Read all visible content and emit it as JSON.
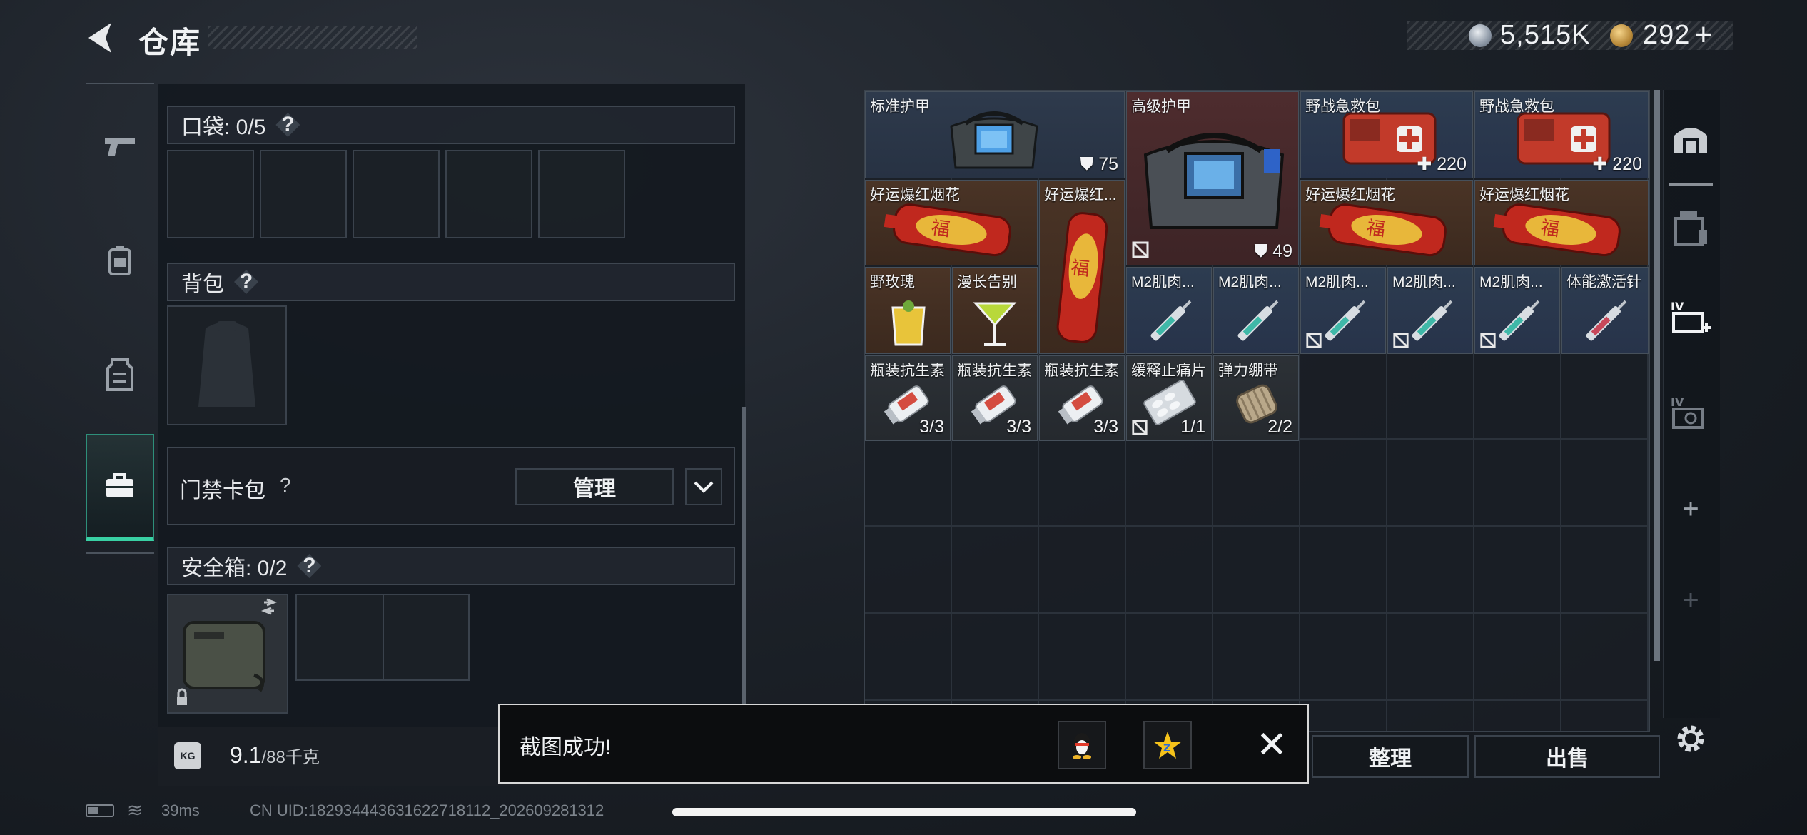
{
  "header": {
    "title": "仓库",
    "currency_silver": "5,515K",
    "currency_gold": "292",
    "plus": "+"
  },
  "nav": [
    "pistol-icon",
    "backpack-gear-icon",
    "vest-icon",
    "briefcase-icon"
  ],
  "pocket": {
    "label": "口袋: 0/5",
    "help": "?"
  },
  "backpack": {
    "label": "背包",
    "help": "?"
  },
  "keycard": {
    "label": "门禁卡包",
    "help": "?",
    "manage": "管理"
  },
  "safe_box": {
    "label": "安全箱: 0/2",
    "help": "?"
  },
  "weight": {
    "current": "9.1",
    "max": "/88千克",
    "icon": "KG"
  },
  "stash_items": [
    {
      "name": "标准护甲",
      "count": "75",
      "badge": "shield"
    },
    {
      "name": "高级护甲",
      "count": "49",
      "badge": "shield"
    },
    {
      "name": "野战急救包",
      "count": "220",
      "badge": "plus"
    },
    {
      "name": "野战急救包",
      "count": "220",
      "badge": "plus"
    },
    {
      "name": "好运爆红烟花",
      "count": ""
    },
    {
      "name": "好运爆红...",
      "count": ""
    },
    {
      "name": "好运爆红烟花",
      "count": ""
    },
    {
      "name": "好运爆红烟花",
      "count": ""
    },
    {
      "name": "野玫瑰",
      "count": ""
    },
    {
      "name": "漫长告别",
      "count": ""
    },
    {
      "name": "M2肌肉...",
      "count": ""
    },
    {
      "name": "M2肌肉...",
      "count": ""
    },
    {
      "name": "M2肌肉...",
      "count": ""
    },
    {
      "name": "M2肌肉...",
      "count": ""
    },
    {
      "name": "M2肌肉...",
      "count": ""
    },
    {
      "name": "体能激活针",
      "count": ""
    },
    {
      "name": "瓶装抗生素",
      "count": "3/3"
    },
    {
      "name": "瓶装抗生素",
      "count": "3/3"
    },
    {
      "name": "瓶装抗生素",
      "count": "3/3"
    },
    {
      "name": "缓释止痛片",
      "count": "1/1"
    },
    {
      "name": "弹力绷带",
      "count": "2/2"
    }
  ],
  "buttons": {
    "sort": "整理",
    "sell": "出售"
  },
  "toast": {
    "message": "截图成功!",
    "close": "✕"
  },
  "status": {
    "ping": "39ms",
    "uid": "CN UID:182934443631622718112_202609281312"
  },
  "colors": {
    "accent": "#39d0a4",
    "toast_border": "#d8d8d8"
  }
}
